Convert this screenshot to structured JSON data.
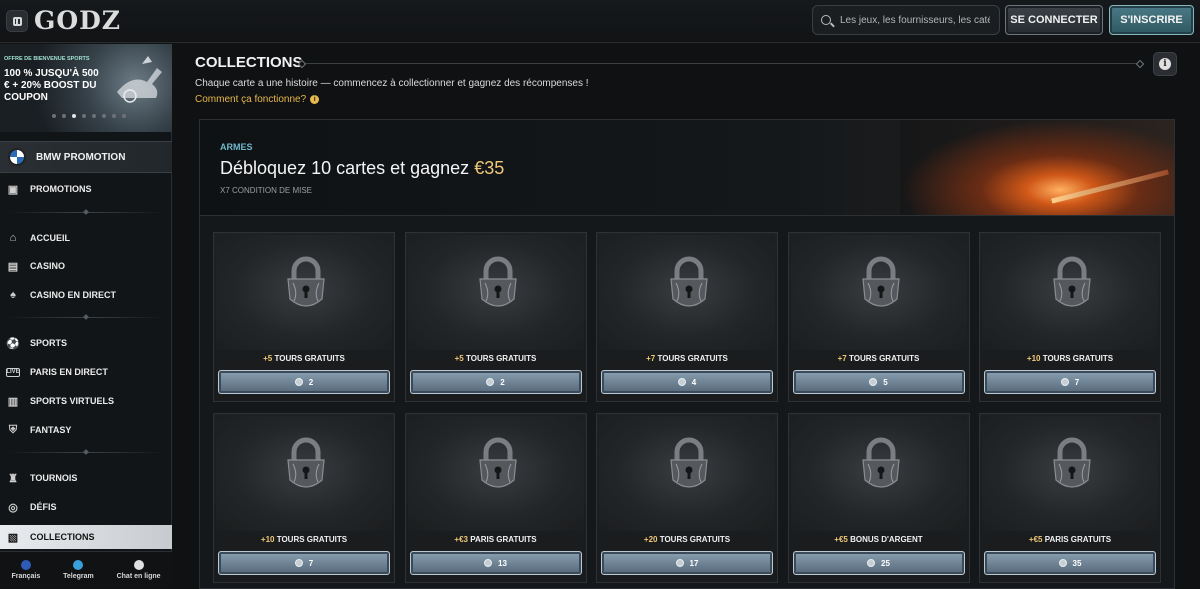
{
  "header": {
    "logo": "GODZ",
    "search_placeholder": "Les jeux, les fournisseurs, les caté...",
    "login_label": "SE CONNECTER",
    "register_label": "S'INSCRIRE"
  },
  "sidebar": {
    "banner": {
      "small": "OFFRE DE BIENVENUE SPORTS",
      "big": "100 % JUSQU'À 500 € + 20% BOOST DU COUPON",
      "slides": 8,
      "active_slide": 2
    },
    "bmw_label": "BMW PROMOTION",
    "items": [
      {
        "label": "PROMOTIONS",
        "icon": "gift-icon"
      },
      {
        "label": "ACCUEIL",
        "icon": "home-icon"
      },
      {
        "label": "CASINO",
        "icon": "casino-icon"
      },
      {
        "label": "CASINO EN DIRECT",
        "icon": "cards-icon"
      },
      {
        "label": "SPORTS",
        "icon": "ball-icon"
      },
      {
        "label": "PARIS EN DIRECT",
        "icon": "live-icon"
      },
      {
        "label": "SPORTS VIRTUELS",
        "icon": "virtual-sports-icon"
      },
      {
        "label": "FANTASY",
        "icon": "fantasy-icon"
      },
      {
        "label": "TOURNOIS",
        "icon": "trophy-icon"
      },
      {
        "label": "DÉFIS",
        "icon": "target-icon"
      },
      {
        "label": "COLLECTIONS",
        "icon": "collections-icon"
      }
    ],
    "bottom": [
      {
        "label": "Français",
        "color": "#2f5ab8"
      },
      {
        "label": "Telegram",
        "color": "#3a9fd8"
      },
      {
        "label": "Chat en ligne",
        "color": "#e0e0e0"
      }
    ]
  },
  "main": {
    "title": "COLLECTIONS",
    "subtitle": "Chaque carte a une histoire — commencez à collectionner et gagnez des récompenses !",
    "howto": "Comment ça fonctionne?",
    "hero": {
      "tag": "ARMES",
      "heading": "Débloquez 10 cartes et gagnez",
      "amount": "€35",
      "wager": "X7 CONDITION DE MISE"
    },
    "cards": [
      {
        "amount": "+5",
        "reward": "TOURS GRATUITS",
        "cost": "2"
      },
      {
        "amount": "+5",
        "reward": "TOURS GRATUITS",
        "cost": "2"
      },
      {
        "amount": "+7",
        "reward": "TOURS GRATUITS",
        "cost": "4"
      },
      {
        "amount": "+7",
        "reward": "TOURS GRATUITS",
        "cost": "5"
      },
      {
        "amount": "+10",
        "reward": "TOURS GRATUITS",
        "cost": "7"
      },
      {
        "amount": "+10",
        "reward": "TOURS GRATUITS",
        "cost": "7"
      },
      {
        "amount": "+€3",
        "reward": "PARIS GRATUITS",
        "cost": "13"
      },
      {
        "amount": "+20",
        "reward": "TOURS GRATUITS",
        "cost": "17"
      },
      {
        "amount": "+€5",
        "reward": "BONUS D'ARGENT",
        "cost": "25"
      },
      {
        "amount": "+€5",
        "reward": "PARIS GRATUITS",
        "cost": "35"
      }
    ]
  }
}
